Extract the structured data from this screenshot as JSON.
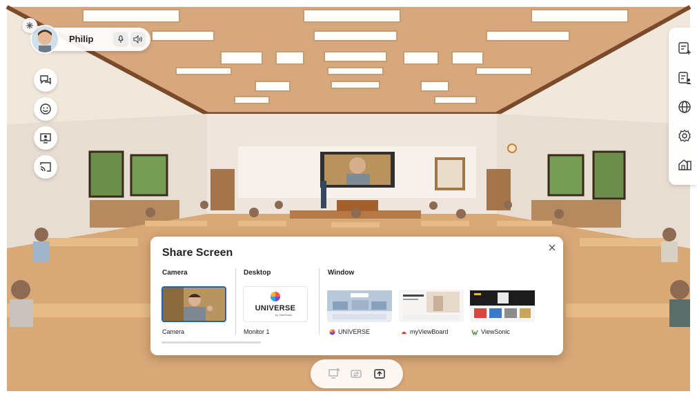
{
  "user": {
    "name": "Philip",
    "avatar_icon": "avatar-icon",
    "mic_icon": "microphone-icon",
    "speaker_icon": "speaker-icon",
    "settings_icon": "sparkle-icon"
  },
  "left_toolbar": [
    {
      "icon": "chat-icon"
    },
    {
      "icon": "emoji-icon"
    },
    {
      "icon": "share-screen-icon"
    },
    {
      "icon": "cast-icon"
    }
  ],
  "right_toolbar": [
    {
      "icon": "add-board-icon"
    },
    {
      "icon": "participants-icon"
    },
    {
      "icon": "globe-icon"
    },
    {
      "icon": "settings-icon"
    },
    {
      "icon": "home-icon"
    }
  ],
  "share_screen": {
    "title": "Share Screen",
    "close_icon": "close-icon",
    "sections": {
      "camera": {
        "label": "Camera",
        "items": [
          {
            "label": "Camera"
          }
        ]
      },
      "desktop": {
        "label": "Desktop",
        "items": [
          {
            "label": "Monitor 1",
            "thumb_text": "UNIVERSE",
            "thumb_sub": "by ViewSonic"
          }
        ]
      },
      "window": {
        "label": "Window",
        "items": [
          {
            "label": "UNIVERSE"
          },
          {
            "label": "myViewBoard"
          },
          {
            "label": "ViewSonic"
          }
        ]
      }
    }
  },
  "bottom_toolbar": [
    {
      "icon": "monitor-icon"
    },
    {
      "icon": "switch-icon"
    },
    {
      "icon": "upload-icon"
    }
  ]
}
